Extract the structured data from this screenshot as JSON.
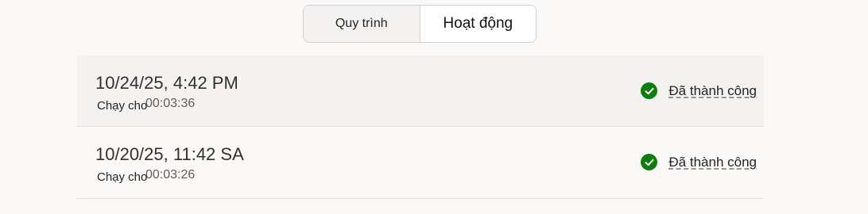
{
  "tabs": [
    {
      "label": "Quy trình",
      "state": "inactive"
    },
    {
      "label": "Hoạt động",
      "state": "active"
    }
  ],
  "runs": [
    {
      "timestamp": "10/24/25, 4:42 PM",
      "duration_label": "Chạy cho",
      "duration": "00:03:36",
      "status": "Đã thành công"
    },
    {
      "timestamp_date": "10/20/25,",
      "timestamp_time": "11:42 SA",
      "duration_label": "Chạy cho",
      "duration": "00:03:26",
      "status": "Đã thành công"
    }
  ],
  "colors": {
    "success": "#107c10",
    "row_hover": "#f3f2f1",
    "background": "#faf9f8"
  },
  "icons": {
    "status": "checkmark-circle-icon"
  }
}
